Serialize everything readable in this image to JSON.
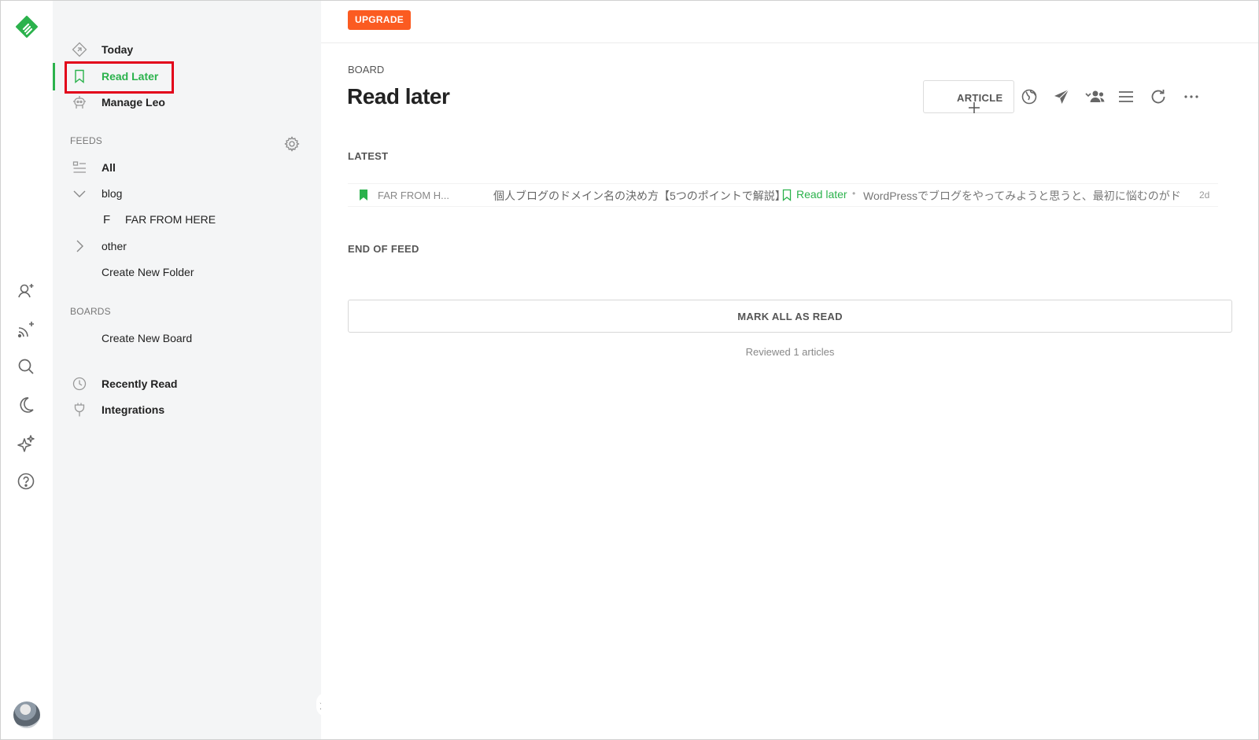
{
  "colors": {
    "accent": "#2bb24c",
    "upgrade": "#fb5b21",
    "highlight": "#e2001a"
  },
  "rail": {
    "icons": [
      "feedly-logo-icon",
      "add-people-icon",
      "add-feed-icon",
      "search-icon",
      "moon-icon",
      "sparkle-icon",
      "help-icon"
    ]
  },
  "sidebar": {
    "nav": {
      "today": "Today",
      "read_later": "Read Later",
      "manage_leo": "Manage Leo"
    },
    "feeds_title": "FEEDS",
    "feeds": {
      "all": "All",
      "blog_folder": "blog",
      "blog_feed_letter": "F",
      "blog_feed": "FAR FROM HERE",
      "other_folder": "other",
      "create_folder": "Create New Folder"
    },
    "boards_title": "BOARDS",
    "boards": {
      "create_board": "Create New Board"
    },
    "footer_nav": {
      "recently_read": "Recently Read",
      "integrations": "Integrations"
    }
  },
  "main": {
    "upgrade_label": "UPGRADE",
    "kicker": "BOARD",
    "title": "Read later",
    "article_button": "ARTICLE",
    "toolbar_icons": [
      "globe-icon",
      "send-icon",
      "team-icon",
      "list-view-icon",
      "refresh-icon",
      "more-icon"
    ],
    "latest_label": "LATEST",
    "entry": {
      "source": "FAR FROM H...",
      "title": "個人ブログのドメイン名の決め方【5つのポイントで解説】",
      "tag": "Read later",
      "separator": "•",
      "summary": "WordPressでブログをやってみようと思うと、最初に悩むのがドメイン",
      "age": "2d"
    },
    "end_label": "END OF FEED",
    "mark_all": "MARK ALL AS READ",
    "reviewed": "Reviewed 1 articles"
  }
}
